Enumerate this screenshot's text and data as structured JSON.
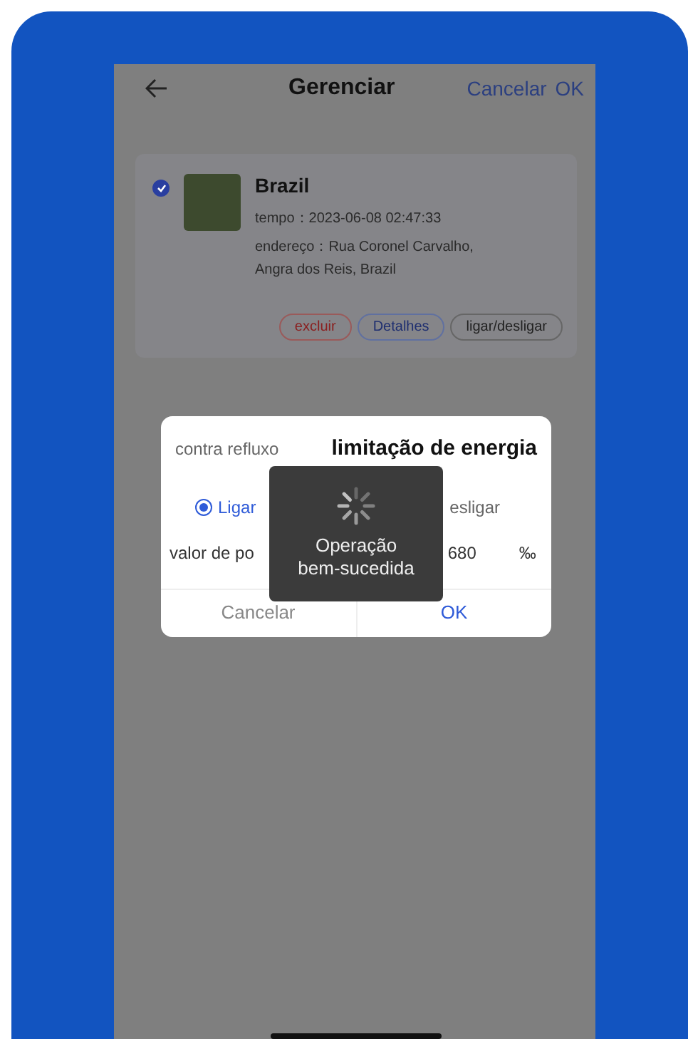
{
  "header": {
    "title": "Gerenciar",
    "actions": [
      "Cancelar",
      "OK"
    ]
  },
  "card": {
    "selected": true,
    "name": "Brazil",
    "time": "tempo：2023-06-08 02:47:33",
    "address": "endereço：Rua Coronel Carvalho, Angra dos Reis, Brazil",
    "buttons": [
      {
        "label": "excluir",
        "kind": "danger"
      },
      {
        "label": "Detalhes",
        "kind": "normal"
      },
      {
        "label": "ligar/desligar",
        "kind": "plain"
      }
    ]
  },
  "dialog": {
    "tabs": [
      {
        "label": "contra refluxo",
        "selected": false
      },
      {
        "label": "limitação de energia",
        "selected": true
      }
    ],
    "options": [
      {
        "label": "Ligar",
        "selected": true
      },
      {
        "label": "esligar",
        "selected": false
      }
    ],
    "value_label": "valor de po",
    "value": "680",
    "unit": "‰",
    "buttons": [
      "Cancelar",
      "OK"
    ]
  },
  "toast": {
    "lines": [
      "Operação",
      "bem-sucedida"
    ]
  }
}
